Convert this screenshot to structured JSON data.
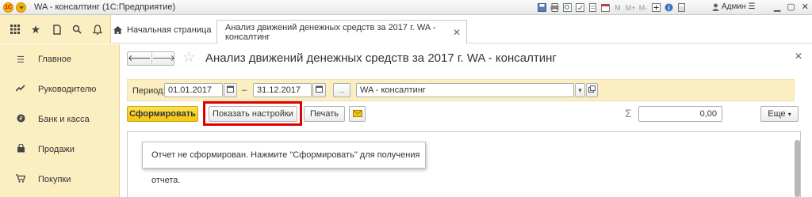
{
  "window": {
    "logo_text": "1С",
    "title": "WA - консалтинг  (1С:Предприятие)",
    "toolbar_icons": [
      "save-icon",
      "print-icon",
      "preview-icon",
      "attach-icon",
      "attach-file-icon",
      "calendar-icon"
    ],
    "memory_labels": [
      "M",
      "M+",
      "M-"
    ],
    "extra_icons": [
      "zoom-in-icon",
      "info-icon",
      "calculator-icon"
    ],
    "user_name": "Админ",
    "user_icon": "user-icon",
    "controls": [
      "minimize",
      "maximize",
      "close"
    ]
  },
  "top": {
    "icons": [
      "apps-grid-icon",
      "favorites-star-icon",
      "history-icon",
      "search-icon",
      "bell-icon"
    ],
    "home_tab": "Начальная страница",
    "active_tab": "Анализ движений денежных средств за 2017 г. WA - консалтинг"
  },
  "sidebar": {
    "items": [
      {
        "label": "Главное",
        "icon": "menu-lines-icon"
      },
      {
        "label": "Руководителю",
        "icon": "trend-icon"
      },
      {
        "label": "Банк и касса",
        "icon": "coin-icon"
      },
      {
        "label": "Продажи",
        "icon": "basket-icon"
      },
      {
        "label": "Покупки",
        "icon": "cart-icon"
      }
    ]
  },
  "form": {
    "title": "Анализ движений денежных средств за 2017 г. WA - консалтинг",
    "period_label": "Период:",
    "date_from": "01.01.2017",
    "date_to": "31.12.2017",
    "dash": "–",
    "period_button": "...",
    "organization": "WA - консалтинг",
    "generate_button": "Сформировать",
    "settings_button": "Показать настройки",
    "print_button": "Печать",
    "sum_symbol": "Σ",
    "sum_value": "0,00",
    "more_button": "Еще",
    "report_message": "Отчет не сформирован. Нажмите \"Сформировать\" для получения отчета."
  },
  "colors": {
    "panel_yellow": "#fbeec0",
    "primary_button": "#f2c70f",
    "highlight_red": "#e00000"
  }
}
